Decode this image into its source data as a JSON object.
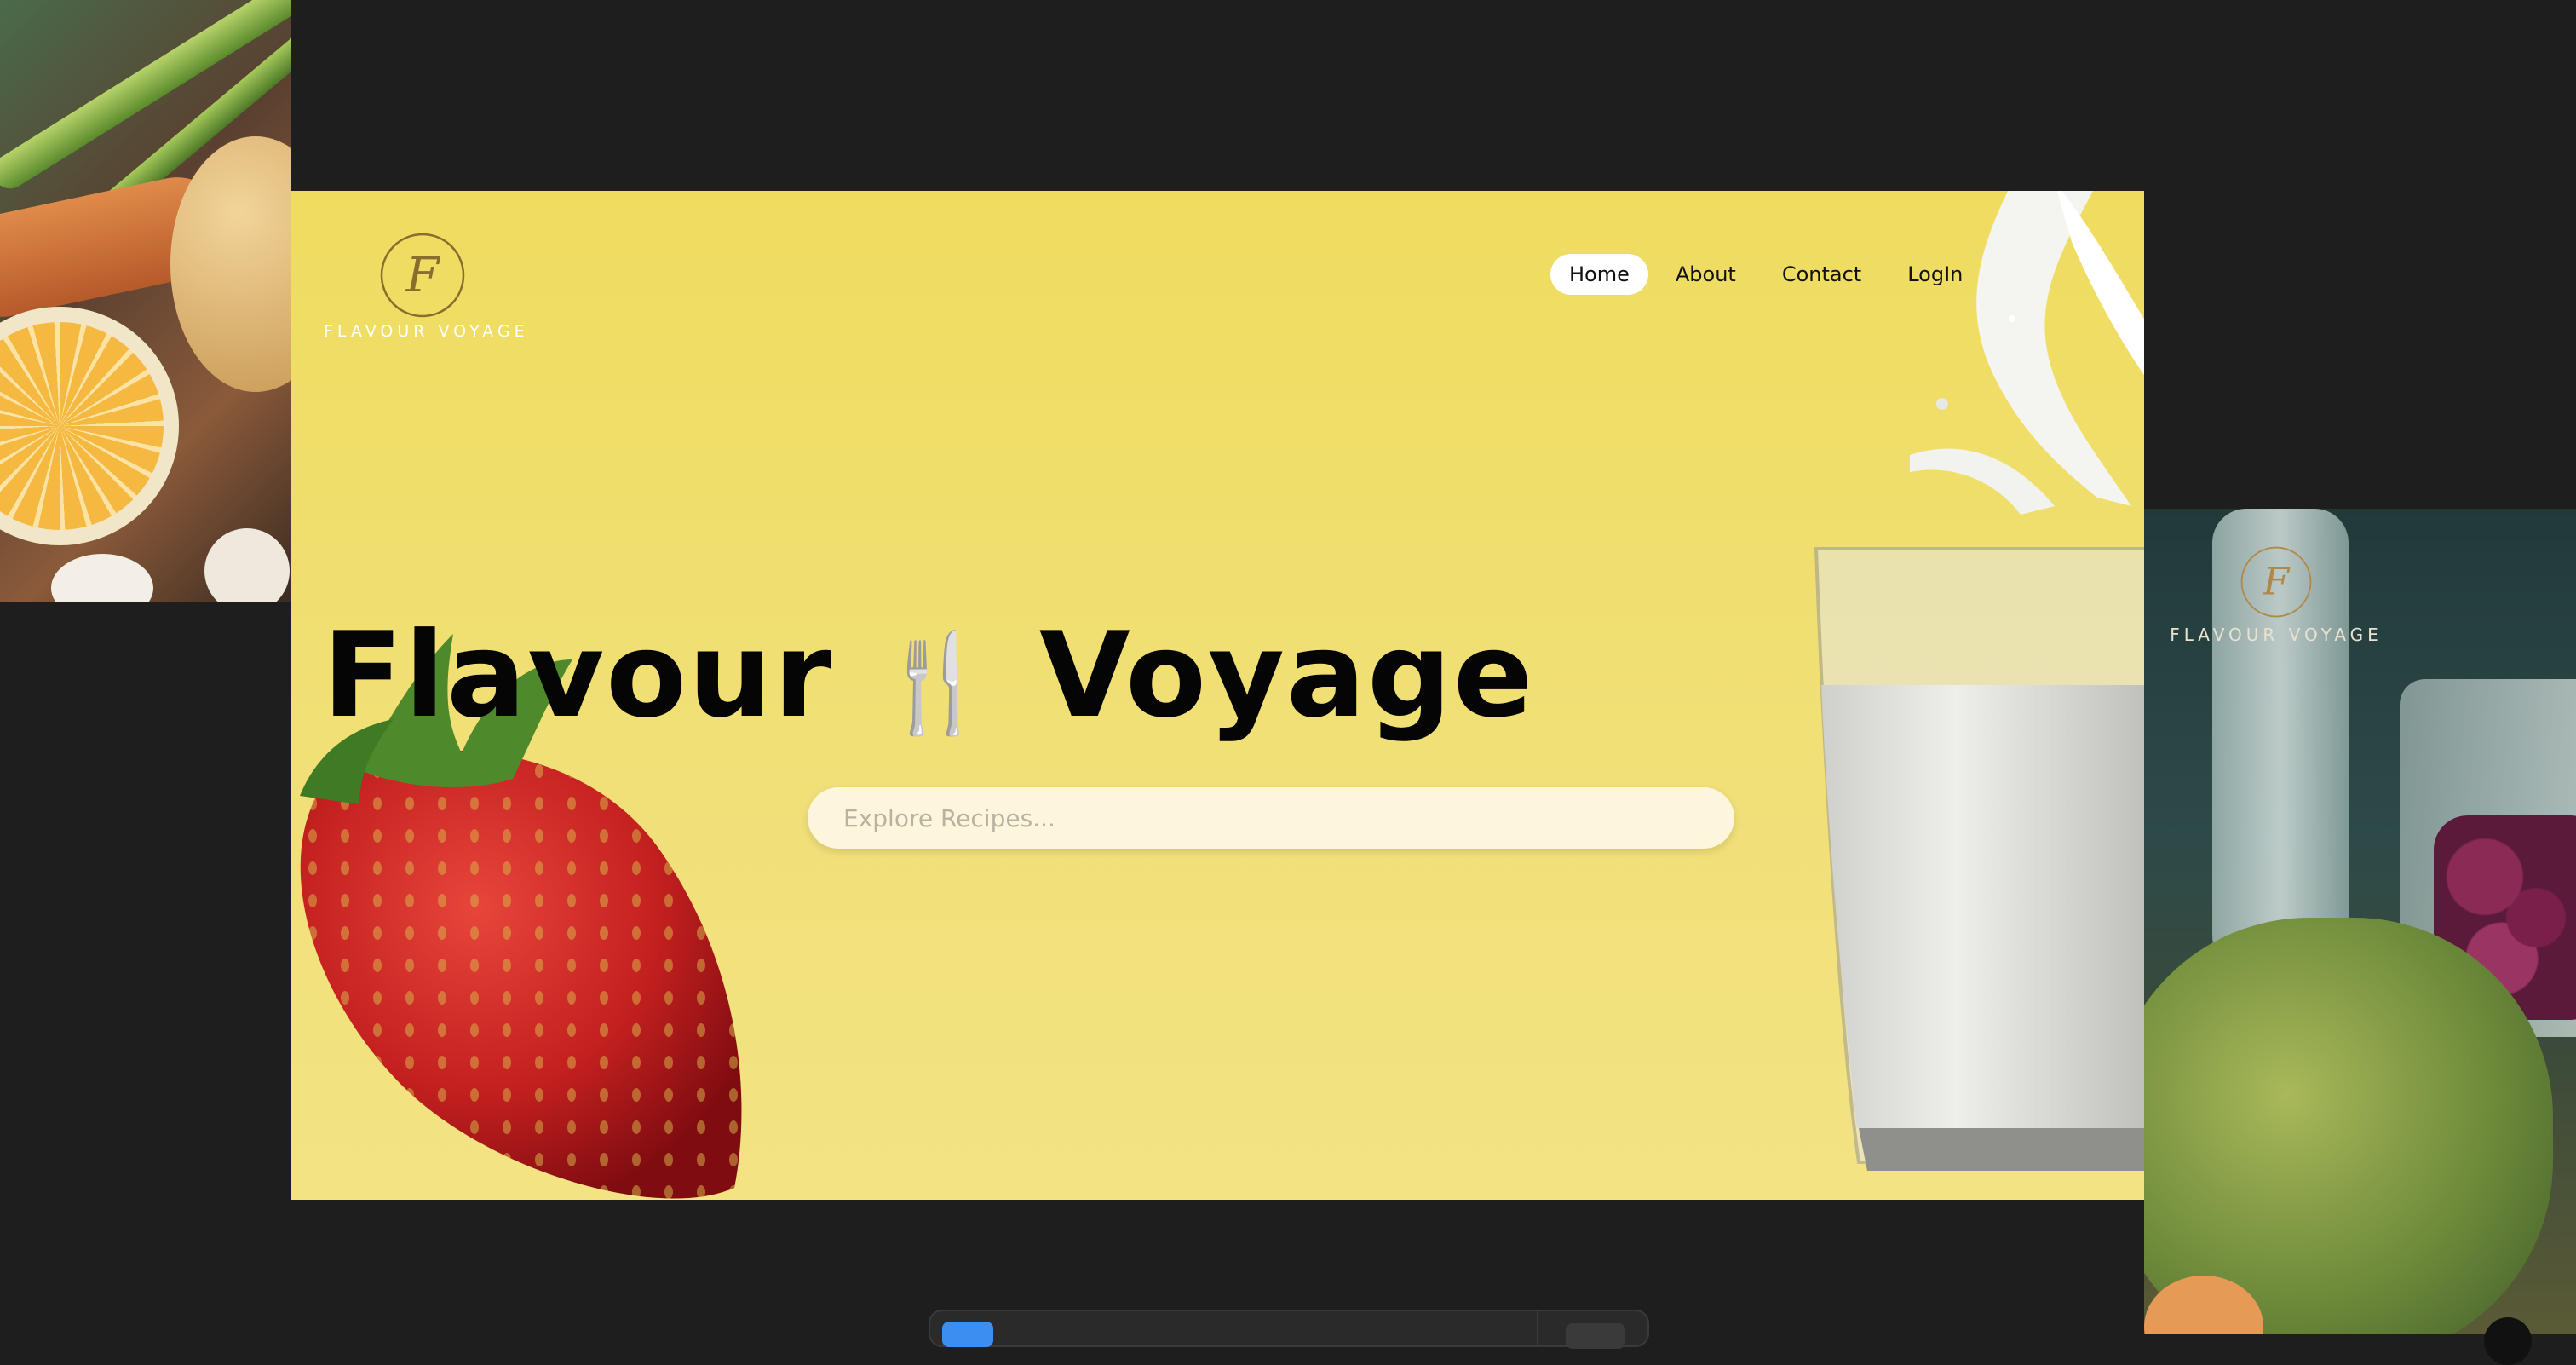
{
  "brand": {
    "logo_letter": "F",
    "name": "FLAVOUR VOYAGE"
  },
  "nav": {
    "items": [
      {
        "label": "Home",
        "active": true
      },
      {
        "label": "About",
        "active": false
      },
      {
        "label": "Contact",
        "active": false
      },
      {
        "label": "LogIn",
        "active": false
      }
    ]
  },
  "hero": {
    "title_left": "Flavour",
    "title_emoji": "🍴",
    "title_right": "Voyage",
    "search_placeholder": "Explore Recipes..."
  },
  "right_preview": {
    "logo_letter": "F",
    "name": "FLAVOUR VOYAGE"
  },
  "colors": {
    "hero_background": "#efdc5f",
    "page_background": "#1e1e1e",
    "logo_gold": "#a8883f"
  }
}
